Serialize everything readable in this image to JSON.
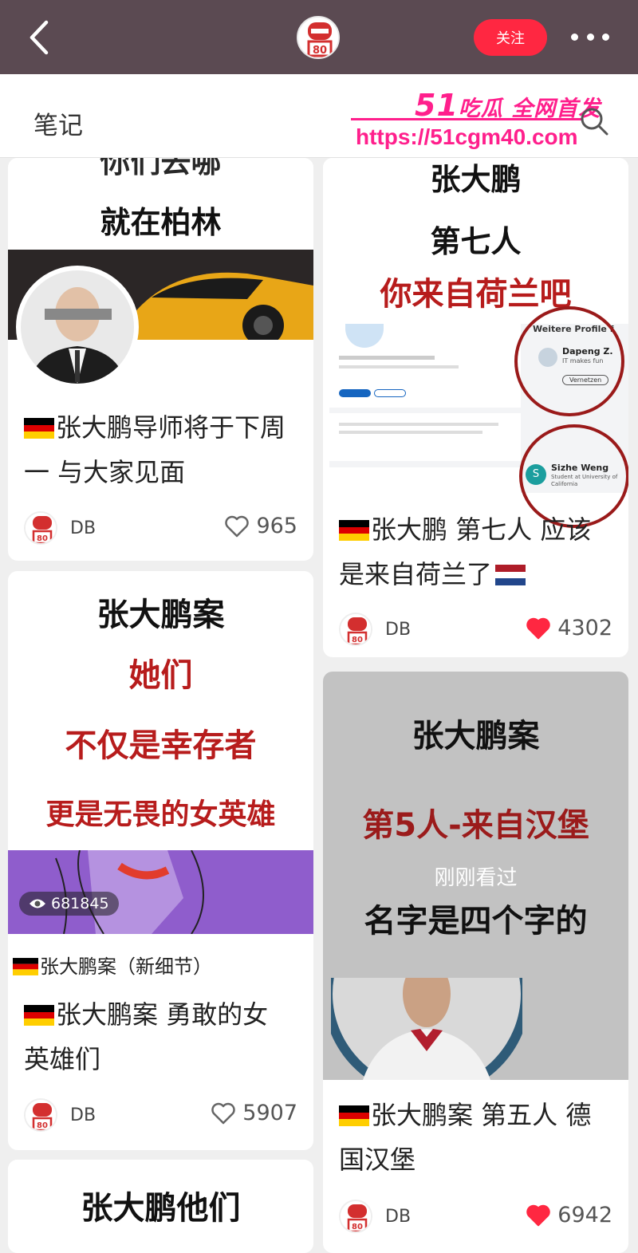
{
  "header": {
    "follow_label": "关注",
    "notes_label": "笔记",
    "avatar_text": "80"
  },
  "watermark": {
    "brand_num": "51",
    "brand_text": "吃瓜 全网首发",
    "url": "https://51cgm40.com"
  },
  "colors": {
    "topbar": "#5b4a52",
    "accent": "#ff2741",
    "watermark": "#ff1f8c",
    "poster_red": "#b71c1c"
  },
  "cards": [
    {
      "cover_lines": [
        "你们去哪",
        "就在柏林"
      ],
      "title": "张大鹏导师将于下周一 与大家见面",
      "title_l1": "张大鹏导师将于下周",
      "title_l2": "一 与大家见面",
      "author": "DB",
      "likes": "965",
      "liked": false
    },
    {
      "cover_lines": [
        "张大鹏",
        "第七人",
        "你来自荷兰吧"
      ],
      "cover_profile_1": "Dapeng Z.",
      "cover_profile_1_sub": "IT makes fun",
      "cover_profile_btn": "Vernetzen",
      "cover_profile_2": "Sizhe Weng",
      "cover_profile_2_sub": "Student at University of California",
      "cover_section": "Weitere Profile f",
      "title_l1": "张大鹏 第七人 应该",
      "title_l2": "是来自荷兰了",
      "author": "DB",
      "likes": "4302",
      "liked": true
    },
    {
      "cover_lines": [
        "张大鹏案",
        "她们",
        "不仅是幸存者",
        "更是无畏的女英雄"
      ],
      "views": "681845",
      "tag_line": "张大鹏案（新细节）",
      "title_l1": "张大鹏案 勇敢的女",
      "title_l2": "英雄们",
      "author": "DB",
      "likes": "5907",
      "liked": false
    },
    {
      "cover_lines": [
        "张大鹏案",
        "第5人-来自汉堡",
        "刚刚看过",
        "名字是四个字的"
      ],
      "title_l1": "张大鹏案 第五人 德",
      "title_l2": "国汉堡",
      "author": "DB",
      "likes": "6942",
      "liked": true
    },
    {
      "cover_lines": [
        "张大鹏他们"
      ]
    }
  ]
}
